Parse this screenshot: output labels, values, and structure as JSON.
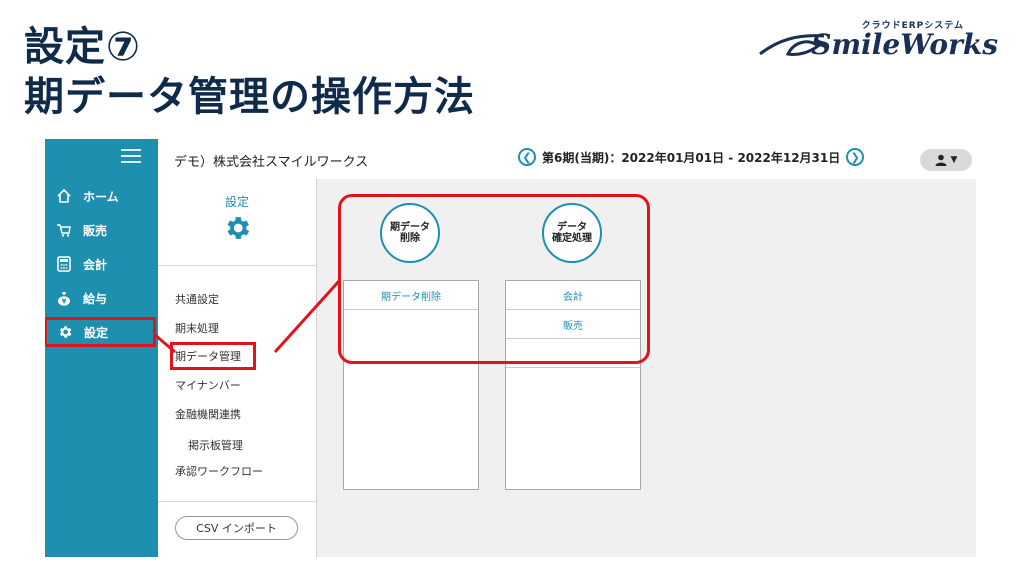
{
  "slide": {
    "title_line1": "設定⑦",
    "title_line2": "期データ管理の操作方法"
  },
  "logo": {
    "tagline": "クラウドERPシステム",
    "name": "SmileWorks"
  },
  "topbar": {
    "company": "デモ）株式会社スマイルワークス",
    "period": "第6期(当期)：2022年01月01日 - 2022年12月31日"
  },
  "sidebar": {
    "items": [
      {
        "label": "ホーム",
        "icon": "home-icon"
      },
      {
        "label": "販売",
        "icon": "cart-icon"
      },
      {
        "label": "会計",
        "icon": "calculator-icon"
      },
      {
        "label": "給与",
        "icon": "money-bag-icon"
      },
      {
        "label": "設定",
        "icon": "gear-icon"
      }
    ]
  },
  "subnav": {
    "title": "設定",
    "items": [
      "共通設定",
      "期末処理",
      "期データ管理",
      "マイナンバー",
      "金融機関連携",
      "掲示板管理",
      "承認ワークフロー"
    ],
    "csv_button": "CSV インポート"
  },
  "panels": [
    {
      "circle_line1": "期データ",
      "circle_line2": "削除",
      "rows": [
        "期データ削除"
      ]
    },
    {
      "circle_line1": "データ",
      "circle_line2": "確定処理",
      "rows": [
        "会計",
        "販売"
      ]
    }
  ],
  "colors": {
    "accent": "#1e8fae",
    "highlight": "#e0141b",
    "title": "#0f2a4a"
  }
}
